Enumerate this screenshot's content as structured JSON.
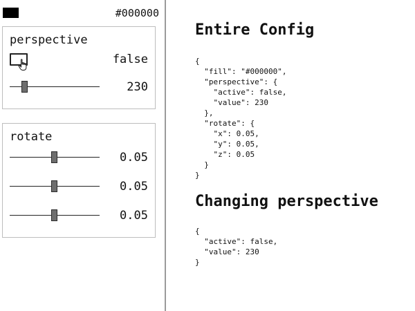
{
  "fill": {
    "value_text": "#000000",
    "swatch_color": "#000000"
  },
  "perspective_group": {
    "title": "perspective",
    "active": {
      "value_text": "false",
      "checked": false
    },
    "value": {
      "value_text": "230",
      "fraction": 0.17
    }
  },
  "rotate_group": {
    "title": "rotate",
    "sliders": [
      {
        "value_text": "0.05",
        "fraction": 0.5
      },
      {
        "value_text": "0.05",
        "fraction": 0.5
      },
      {
        "value_text": "0.05",
        "fraction": 0.5
      }
    ]
  },
  "content": {
    "config_heading": "Entire Config",
    "config_code": "{\n  \"fill\": \"#000000\",\n  \"perspective\": {\n    \"active\": false,\n    \"value\": 230\n  },\n  \"rotate\": {\n    \"x\": 0.05,\n    \"y\": 0.05,\n    \"z\": 0.05\n  }\n}",
    "changing_heading": "Changing perspective",
    "changing_code": "{\n  \"active\": false,\n  \"value\": 230\n}"
  },
  "icons": {
    "cursor": "hand-pointer-icon"
  }
}
